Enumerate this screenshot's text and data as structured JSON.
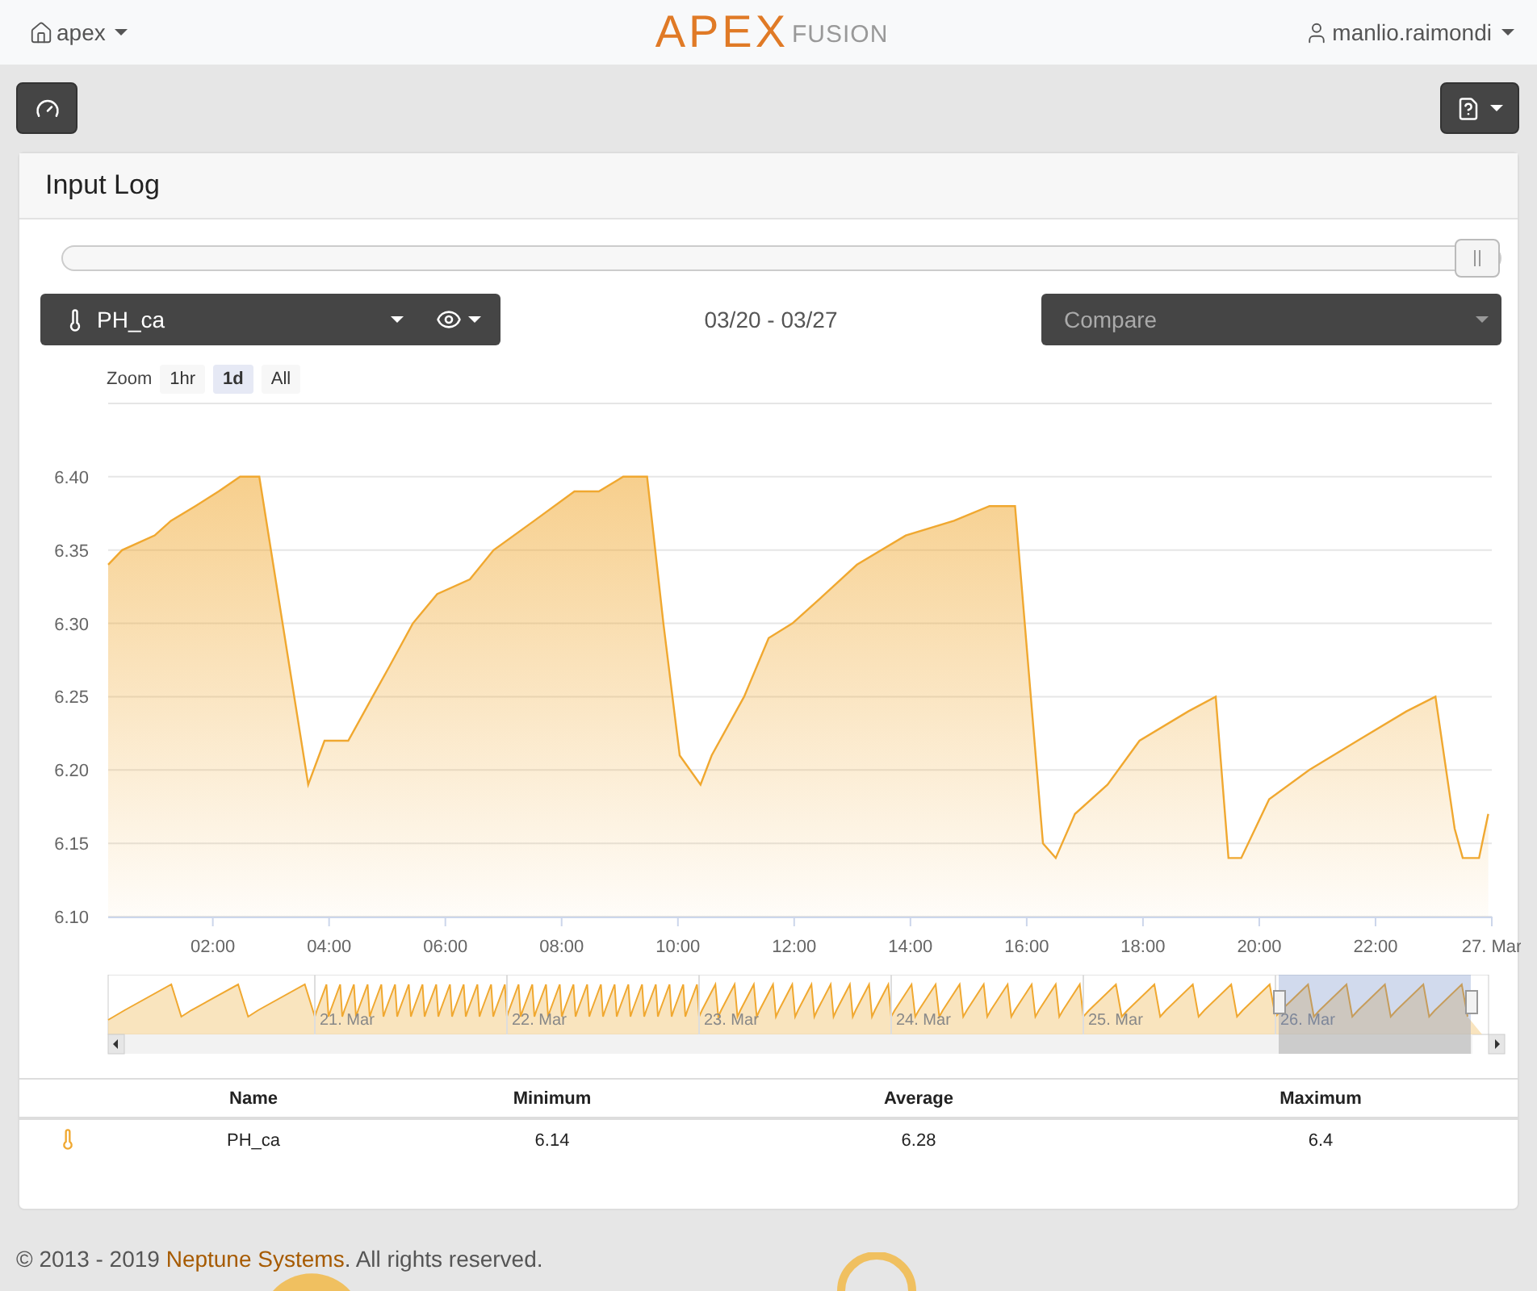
{
  "navbar": {
    "home": "apex",
    "logo_main": "APEX",
    "logo_sub": "FUSION",
    "user": "manlio.raimondi"
  },
  "panel": {
    "title": "Input Log"
  },
  "range_slider": {
    "level": 1
  },
  "sensor_select": {
    "value": "PH_ca"
  },
  "date_range": "03/20 - 03/27",
  "compare_select": {
    "placeholder": "Compare"
  },
  "zoom": {
    "label": "Zoom",
    "options": [
      {
        "label": "1hr",
        "selected": false
      },
      {
        "label": "1d",
        "selected": true
      },
      {
        "label": "All",
        "selected": false
      }
    ]
  },
  "chart_data": {
    "type": "area",
    "grid": true,
    "xlim": [
      0.2,
      24
    ],
    "ylim": [
      6.1,
      6.45
    ],
    "x": [
      0.2,
      0.44,
      1.0,
      1.28,
      1.7,
      2.1,
      2.47,
      2.8,
      3.08,
      3.36,
      3.64,
      3.92,
      4.33,
      4.75,
      5.03,
      5.44,
      5.86,
      6.42,
      6.83,
      7.53,
      8.22,
      8.64,
      9.06,
      9.47,
      9.75,
      10.03,
      10.39,
      10.58,
      11.14,
      11.56,
      11.97,
      12.53,
      13.08,
      13.92,
      14.75,
      15.36,
      15.8,
      16.28,
      16.5,
      16.83,
      17.39,
      17.94,
      18.78,
      19.25,
      19.47,
      19.69,
      20.17,
      20.86,
      21.69,
      22.53,
      23.03,
      23.36,
      23.5,
      23.78,
      23.94
    ],
    "series": [
      {
        "color": "#f0a830",
        "values": [
          6.34,
          6.35,
          6.36,
          6.37,
          6.38,
          6.39,
          6.4,
          6.4,
          6.33,
          6.26,
          6.19,
          6.22,
          6.22,
          6.25,
          6.27,
          6.3,
          6.32,
          6.33,
          6.35,
          6.37,
          6.39,
          6.39,
          6.4,
          6.4,
          6.3,
          6.21,
          6.19,
          6.21,
          6.25,
          6.29,
          6.3,
          6.32,
          6.34,
          6.36,
          6.37,
          6.38,
          6.38,
          6.15,
          6.14,
          6.17,
          6.19,
          6.22,
          6.24,
          6.25,
          6.14,
          6.14,
          6.18,
          6.2,
          6.22,
          6.24,
          6.25,
          6.16,
          6.14,
          6.14,
          6.17
        ]
      }
    ],
    "xticks": [
      {
        "value": 2,
        "label": "02:00"
      },
      {
        "value": 4,
        "label": "04:00"
      },
      {
        "value": 6,
        "label": "06:00"
      },
      {
        "value": 8,
        "label": "08:00"
      },
      {
        "value": 10,
        "label": "10:00"
      },
      {
        "value": 12,
        "label": "12:00"
      },
      {
        "value": 14,
        "label": "14:00"
      },
      {
        "value": 16,
        "label": "16:00"
      },
      {
        "value": 18,
        "label": "18:00"
      },
      {
        "value": 20,
        "label": "20:00"
      },
      {
        "value": 22,
        "label": "22:00"
      },
      {
        "value": 24,
        "label": "27. Mar"
      }
    ],
    "yticks": [
      {
        "value": 6.1,
        "label": "6.10"
      },
      {
        "value": 6.15,
        "label": "6.15"
      },
      {
        "value": 6.2,
        "label": "6.20"
      },
      {
        "value": 6.25,
        "label": "6.25"
      },
      {
        "value": 6.3,
        "label": "6.30"
      },
      {
        "value": 6.35,
        "label": "6.35"
      },
      {
        "value": 6.4,
        "label": "6.40"
      }
    ]
  },
  "navigator": {
    "labels": [
      "21. Mar",
      "22. Mar",
      "23. Mar",
      "24. Mar",
      "25. Mar",
      "26. Mar"
    ]
  },
  "table": {
    "columns": [
      "Name",
      "Minimum",
      "Average",
      "Maximum"
    ],
    "rows": [
      {
        "name": "PH_ca",
        "minimum": "6.14",
        "average": "6.28",
        "maximum": "6.4"
      }
    ]
  },
  "footer": {
    "prefix": "© 2013 - 2019 ",
    "link": "Neptune Systems",
    "suffix": ". All rights reserved."
  }
}
